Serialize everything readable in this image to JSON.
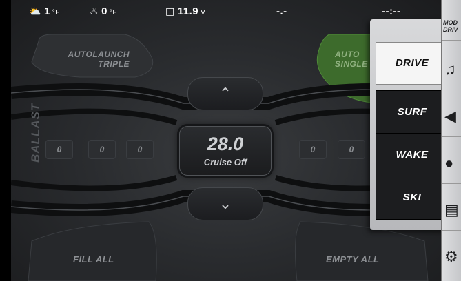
{
  "status_bar": {
    "air_temp": {
      "icon": "sun-cloud-icon",
      "value": "1",
      "unit": "°F"
    },
    "water_temp": {
      "icon": "water-temp-icon",
      "value": "0",
      "unit": "°F"
    },
    "battery": {
      "icon": "battery-icon",
      "value": "11.9",
      "unit": "V"
    },
    "depth": "-.-",
    "clock": "--:--"
  },
  "autolaunch": {
    "left_label": "AUTOLAUNCH\nTRIPLE",
    "right_label": "AUTO\nSINGLE"
  },
  "ballast": {
    "label": "BALLAST",
    "left_values": [
      "0",
      "0",
      "0"
    ],
    "right_values": [
      "0",
      "0"
    ]
  },
  "cruise": {
    "speed": "28.0",
    "status": "Cruise Off"
  },
  "buttons": {
    "fill_all": "FILL ALL",
    "empty_all": "EMPTY ALL"
  },
  "mode_menu": {
    "items": [
      "DRIVE",
      "SURF",
      "WAKE",
      "SKI"
    ],
    "selected": "DRIVE"
  },
  "sidebar": {
    "mode_label": "MOD\nDRIV",
    "icons": [
      "music-icon",
      "speaker-icon",
      "light-bulb-icon",
      "dashboard-icon",
      "gear-icon"
    ]
  },
  "colors": {
    "accent_green": "#3d6b2c",
    "selected_mode": "#f5f5f5"
  }
}
